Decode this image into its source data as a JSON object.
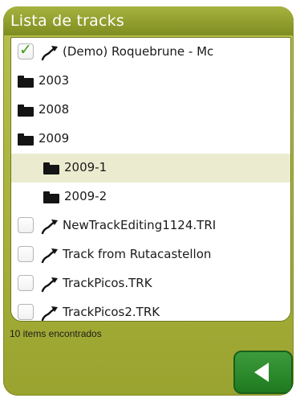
{
  "window": {
    "title": "Lista de tracks"
  },
  "rows": [
    {
      "type": "track",
      "checked": true,
      "label": "(Demo) Roquebrune - Mc"
    },
    {
      "type": "folder",
      "label": "2003"
    },
    {
      "type": "folder",
      "label": "2008"
    },
    {
      "type": "folder",
      "label": "2009"
    },
    {
      "type": "subfolder",
      "label": "2009-1",
      "selected": true
    },
    {
      "type": "subfolder",
      "label": "2009-2"
    },
    {
      "type": "track",
      "checked": false,
      "label": "NewTrackEditing1124.TRI"
    },
    {
      "type": "track",
      "checked": false,
      "label": "Track from Rutacastellon"
    },
    {
      "type": "track",
      "checked": false,
      "label": "TrackPicos.TRK"
    },
    {
      "type": "track",
      "checked": false,
      "label": "TrackPicos2.TRK"
    }
  ],
  "status": {
    "text": "10 items encontrados"
  },
  "icons": {
    "checkmark": "✓",
    "folder": "folder-icon",
    "track": "track-route-icon",
    "back": "back-arrow-icon"
  },
  "colors": {
    "accent": "#a9b13c",
    "back_button": "#2a8a2a",
    "selected_row": "#ebebcf"
  }
}
